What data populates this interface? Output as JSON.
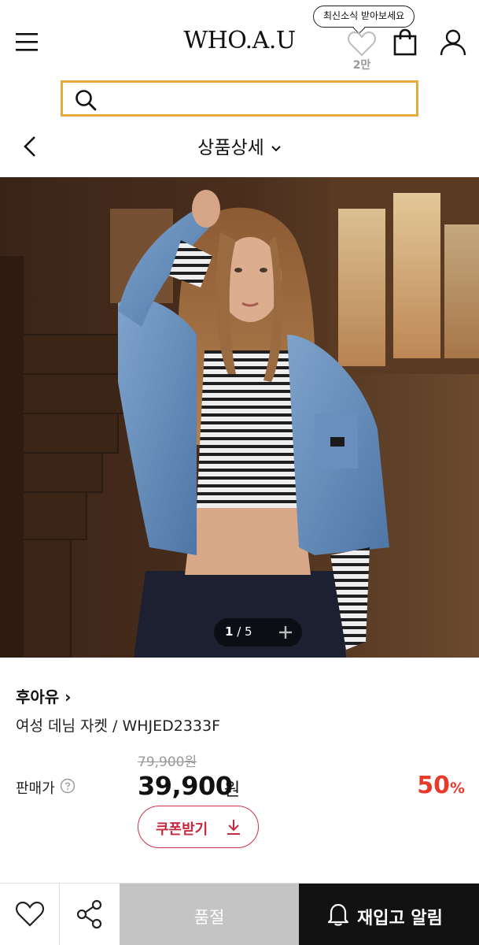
{
  "header": {
    "logo": "WHO.A.U",
    "tooltip": "최신소식 받아보세요",
    "wish_count": "2만"
  },
  "search": {
    "placeholder": ""
  },
  "subnav": {
    "title": "상품상세"
  },
  "gallery": {
    "current": "1",
    "separator": " / ",
    "total": "5"
  },
  "product": {
    "brand": "후아유",
    "brand_chevron": "›",
    "name": "여성 데님 자켓 / WHJED2333F",
    "original_price": "79,900원",
    "price_label": "판매가",
    "price": "39,900",
    "price_unit": "원",
    "discount": "50",
    "discount_unit": "%",
    "coupon_label": "쿠폰받기"
  },
  "bottom_bar": {
    "sold_out_label": "품절",
    "restock_label": "재입고 알림"
  },
  "colors": {
    "search_border": "#e8a93a",
    "discount": "#e83a2a",
    "coupon": "#c8283e",
    "sold_out_bg": "#c4c4c4",
    "restock_bg": "#121212"
  }
}
